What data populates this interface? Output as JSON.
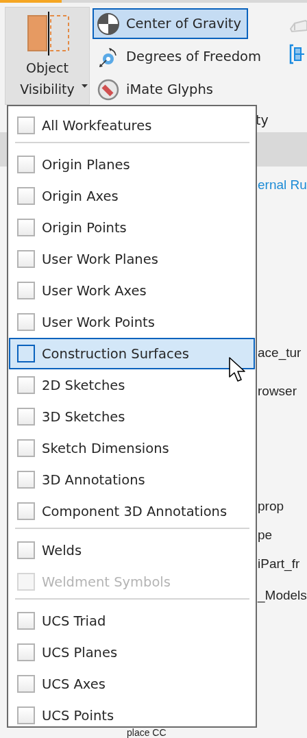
{
  "ribbon": {
    "object_visibility": {
      "label": "Object Visibility",
      "expanded": true
    },
    "tools": [
      {
        "kind": "gravity",
        "label": "Center of Gravity",
        "selected": true
      },
      {
        "kind": "freedom",
        "label": "Degrees of Freedom",
        "selected": false
      },
      {
        "kind": "imate",
        "label": "iMate Glyphs",
        "selected": false
      }
    ],
    "panel_label": "ty"
  },
  "browser": {
    "items": [
      {
        "label": "ernal Ru",
        "kind": "link"
      },
      {
        "label": "ace_tur",
        "kind": "node"
      },
      {
        "label": "rowser",
        "kind": "node"
      },
      {
        "label": "prop",
        "kind": "node"
      },
      {
        "label": "pe",
        "kind": "node"
      },
      {
        "label": "iPart_fr",
        "kind": "node"
      },
      {
        "label": "_Models",
        "kind": "node"
      },
      {
        "label": "place CC",
        "kind": "node"
      }
    ]
  },
  "menu": {
    "groups": [
      [
        {
          "label": "All Workfeatures",
          "checked": false,
          "disabled": false,
          "hovered": false
        }
      ],
      [
        {
          "label": "Origin Planes",
          "checked": false,
          "disabled": false,
          "hovered": false
        },
        {
          "label": "Origin Axes",
          "checked": false,
          "disabled": false,
          "hovered": false
        },
        {
          "label": "Origin Points",
          "checked": false,
          "disabled": false,
          "hovered": false
        },
        {
          "label": "User Work Planes",
          "checked": false,
          "disabled": false,
          "hovered": false
        },
        {
          "label": "User Work Axes",
          "checked": false,
          "disabled": false,
          "hovered": false
        },
        {
          "label": "User Work Points",
          "checked": false,
          "disabled": false,
          "hovered": false
        },
        {
          "label": "Construction Surfaces",
          "checked": false,
          "disabled": false,
          "hovered": true
        },
        {
          "label": "2D Sketches",
          "checked": false,
          "disabled": false,
          "hovered": false
        },
        {
          "label": "3D Sketches",
          "checked": false,
          "disabled": false,
          "hovered": false
        },
        {
          "label": "Sketch Dimensions",
          "checked": false,
          "disabled": false,
          "hovered": false
        },
        {
          "label": "3D Annotations",
          "checked": false,
          "disabled": false,
          "hovered": false
        },
        {
          "label": "Component 3D Annotations",
          "checked": false,
          "disabled": false,
          "hovered": false
        }
      ],
      [
        {
          "label": "Welds",
          "checked": false,
          "disabled": false,
          "hovered": false
        },
        {
          "label": "Weldment Symbols",
          "checked": false,
          "disabled": true,
          "hovered": false
        }
      ],
      [
        {
          "label": "UCS Triad",
          "checked": false,
          "disabled": false,
          "hovered": false
        },
        {
          "label": "UCS Planes",
          "checked": false,
          "disabled": false,
          "hovered": false
        },
        {
          "label": "UCS Axes",
          "checked": false,
          "disabled": false,
          "hovered": false
        },
        {
          "label": "UCS Points",
          "checked": false,
          "disabled": false,
          "hovered": false
        }
      ]
    ]
  }
}
